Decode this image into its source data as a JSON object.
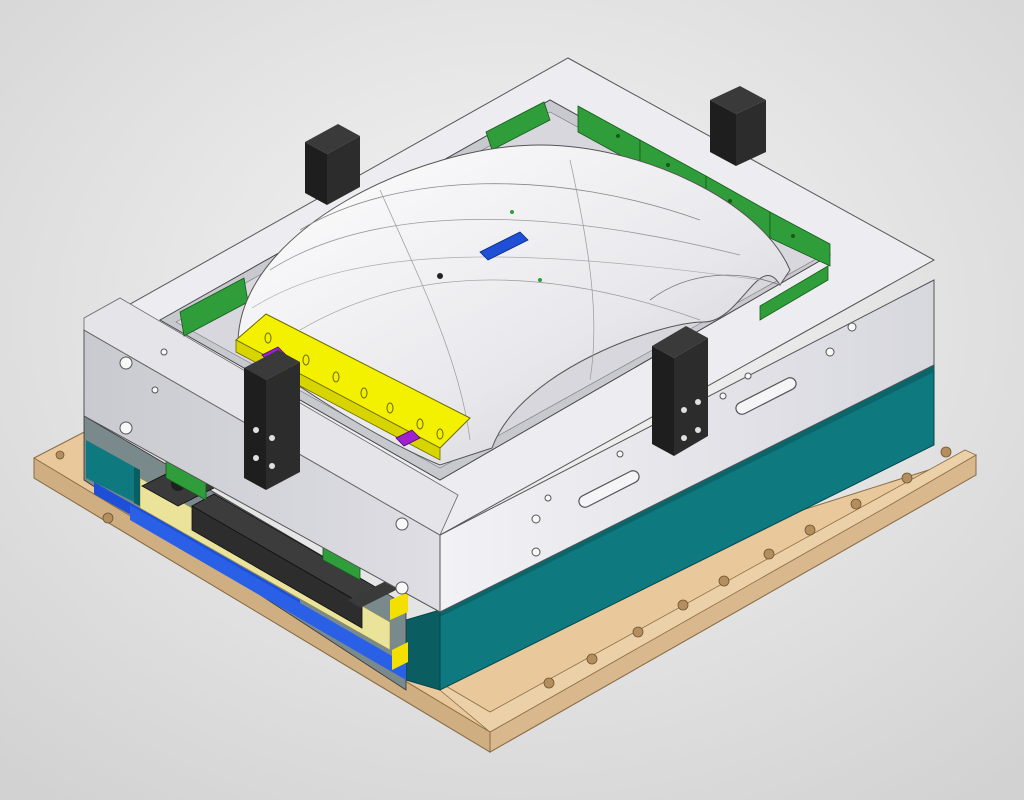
{
  "scene": {
    "subject": "mold-assembly-isometric",
    "colors": {
      "background": "#e6e6e6",
      "base_plate": "#e8c9a0",
      "teal_plate": "#0e7a7f",
      "mold_block": "#e9e9ee",
      "cavity_part": "#f2f2f4",
      "yellow_insert": "#f3f000",
      "green_guide": "#2f9e3a",
      "dark_block": "#2a2a2a",
      "blue_strip": "#1f4fd6",
      "purple_marker": "#a020d0"
    }
  }
}
